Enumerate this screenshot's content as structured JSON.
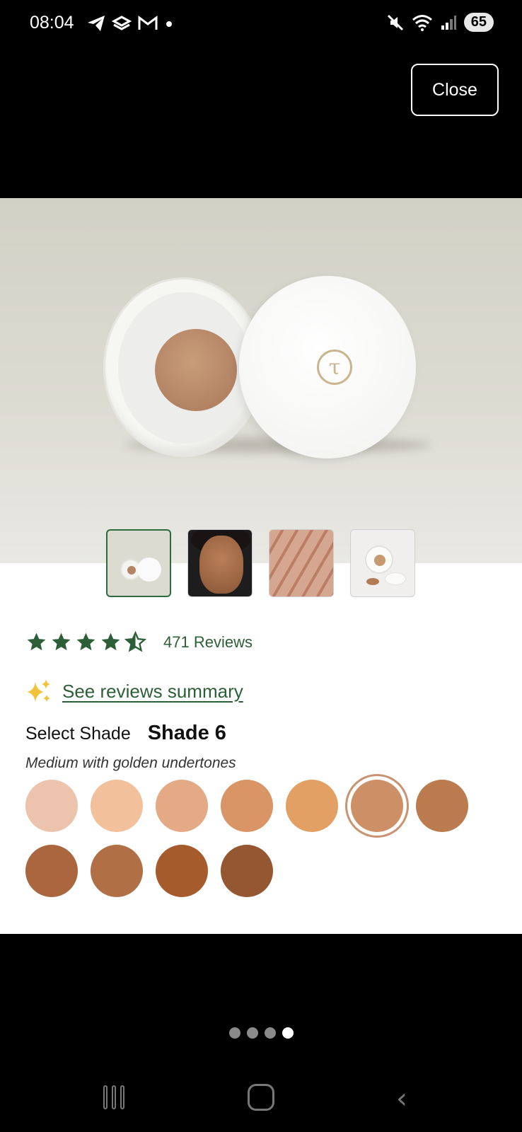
{
  "status_bar": {
    "time": "08:04",
    "battery": "65",
    "left_icons": [
      "telegram-icon",
      "stack-icon",
      "gmail-icon",
      "dot-icon"
    ],
    "right_icons": [
      "mute-icon",
      "wifi-icon",
      "signal-icon"
    ]
  },
  "header": {
    "close_label": "Close"
  },
  "gallery": {
    "thumbnails": [
      {
        "name": "product-jars"
      },
      {
        "name": "model-face"
      },
      {
        "name": "powder-texture"
      },
      {
        "name": "product-spilled"
      }
    ],
    "selected_index": 0,
    "page_dots": 4,
    "active_dot": 3
  },
  "rating": {
    "stars": 4.5,
    "reviews_label": "471 Reviews",
    "star_color": "#2d5f37"
  },
  "summary": {
    "link_label": "See reviews summary",
    "sparkle_color": "#f2c23a"
  },
  "shade": {
    "select_label": "Select Shade",
    "selected_name": "Shade 6",
    "description": "Medium with golden undertones",
    "swatches": [
      "#ecc4ad",
      "#f3c09c",
      "#e3aa85",
      "#d99566",
      "#e2a064",
      "#cd8f66",
      "#bb7b4f",
      "#a9663f",
      "#b06f45",
      "#a55b2b",
      "#955632"
    ],
    "selected_swatch": 5
  },
  "colors": {
    "accent_green": "#2d5f37"
  }
}
